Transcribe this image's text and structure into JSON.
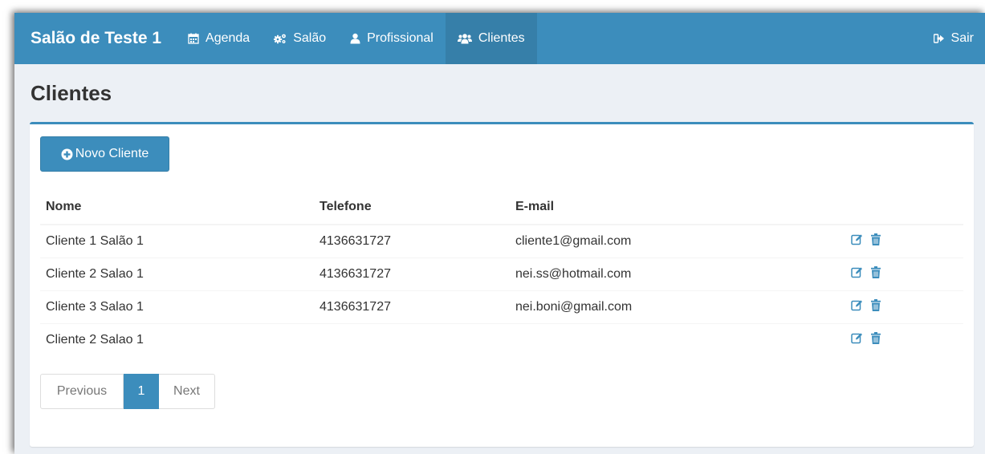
{
  "navbar": {
    "brand": "Salão de Teste 1",
    "items": [
      {
        "label": "Agenda",
        "icon": "calendar-icon"
      },
      {
        "label": "Salão",
        "icon": "gears-icon"
      },
      {
        "label": "Profissional",
        "icon": "user-icon"
      },
      {
        "label": "Clientes",
        "icon": "users-icon",
        "active": true
      }
    ],
    "logout_label": "Sair",
    "logout_icon": "sign-out-icon",
    "color": "#3c8dbc",
    "active_color": "#367fa9"
  },
  "page": {
    "title": "Clientes"
  },
  "toolbar": {
    "new_label": "Novo Cliente",
    "new_icon": "plus-circle-icon"
  },
  "table": {
    "headers": {
      "nome": "Nome",
      "telefone": "Telefone",
      "email": "E-mail"
    },
    "rows": [
      {
        "nome": "Cliente 1 Salão 1",
        "telefone": "4136631727",
        "email": "cliente1@gmail.com"
      },
      {
        "nome": "Cliente 2 Salao 1",
        "telefone": "4136631727",
        "email": "nei.ss@hotmail.com"
      },
      {
        "nome": "Cliente 3 Salao 1",
        "telefone": "4136631727",
        "email": "nei.boni@gmail.com"
      },
      {
        "nome": "Cliente 2 Salao 1",
        "telefone": "",
        "email": ""
      }
    ],
    "row_actions": [
      "edit-icon",
      "trash-icon"
    ]
  },
  "pagination": {
    "previous_label": "Previous",
    "current_page": "1",
    "next_label": "Next"
  }
}
